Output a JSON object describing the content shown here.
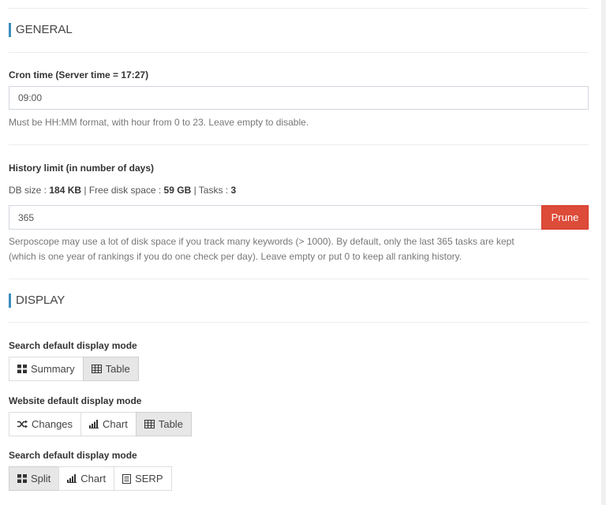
{
  "general": {
    "title": "GENERAL",
    "cron": {
      "label": "Cron time (Server time = 17:27)",
      "value": "09:00",
      "help": "Must be HH:MM format, with hour from 0 to 23. Leave empty to disable."
    },
    "history": {
      "label": "History limit (in number of days)",
      "db_size_label": "DB size : ",
      "db_size_value": "184 KB",
      "free_space_label": " | Free disk space : ",
      "free_space_value": "59 GB",
      "tasks_label": " | Tasks : ",
      "tasks_value": "3",
      "value": "365",
      "prune_label": "Prune",
      "help_line1": "Serposcope may use a lot of disk space if you track many keywords (> 1000). By default, only the last 365 tasks are kept",
      "help_line2": "(which is one year of rankings if you do one check per day). Leave empty or put 0 to keep all ranking history."
    }
  },
  "display": {
    "title": "DISPLAY",
    "search_mode": {
      "label": "Search default display mode",
      "options": [
        {
          "label": "Summary",
          "icon": "grid-icon",
          "active": false
        },
        {
          "label": "Table",
          "icon": "table-icon",
          "active": true
        }
      ]
    },
    "website_mode": {
      "label": "Website default display mode",
      "options": [
        {
          "label": "Changes",
          "icon": "shuffle-icon",
          "active": false
        },
        {
          "label": "Chart",
          "icon": "bar-chart-icon",
          "active": false
        },
        {
          "label": "Table",
          "icon": "table-icon",
          "active": true
        }
      ]
    },
    "search_mode2": {
      "label": "Search default display mode",
      "options": [
        {
          "label": "Split",
          "icon": "grid-icon",
          "active": true
        },
        {
          "label": "Chart",
          "icon": "bar-chart-icon",
          "active": false
        },
        {
          "label": "SERP",
          "icon": "list-icon",
          "active": false
        }
      ]
    }
  },
  "colors": {
    "accent": "#3c8dbc",
    "danger": "#dd4b39"
  }
}
